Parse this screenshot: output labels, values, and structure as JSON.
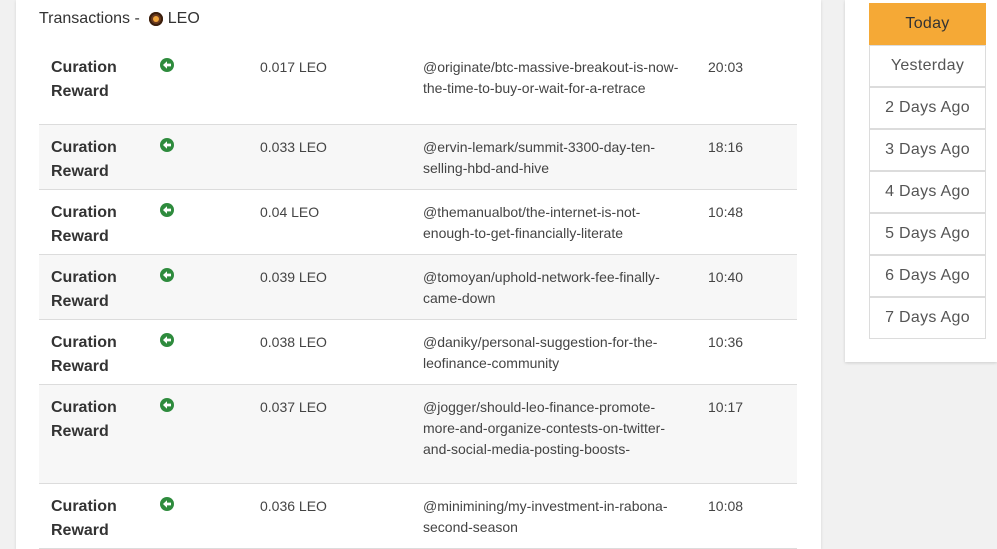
{
  "header": {
    "title": "Transactions -",
    "token": "LEO"
  },
  "colors": {
    "accent": "#f5a936",
    "incoming_icon": "#2e8b3d"
  },
  "transactions": [
    {
      "type": "Curation Reward",
      "icon": "arrow-left-circle-icon",
      "amount": "0.017 LEO",
      "memo": "@originate/btc-massive-breakout-is-now-the-time-to-buy-or-wait-for-a-retrace",
      "time": "20:03"
    },
    {
      "type": "Curation Reward",
      "icon": "arrow-left-circle-icon",
      "amount": "0.033 LEO",
      "memo": "@ervin-lemark/summit-3300-day-ten-selling-hbd-and-hive",
      "time": "18:16"
    },
    {
      "type": "Curation Reward",
      "icon": "arrow-left-circle-icon",
      "amount": "0.04 LEO",
      "memo": "@themanualbot/the-internet-is-not-enough-to-get-financially-literate",
      "time": "10:48"
    },
    {
      "type": "Curation Reward",
      "icon": "arrow-left-circle-icon",
      "amount": "0.039 LEO",
      "memo": "@tomoyan/uphold-network-fee-finally-came-down",
      "time": "10:40"
    },
    {
      "type": "Curation Reward",
      "icon": "arrow-left-circle-icon",
      "amount": "0.038 LEO",
      "memo": "@daniky/personal-suggestion-for-the-leofinance-community",
      "time": "10:36"
    },
    {
      "type": "Curation Reward",
      "icon": "arrow-left-circle-icon",
      "amount": "0.037 LEO",
      "memo": "@jogger/should-leo-finance-promote-more-and-organize-contests-on-twitter-and-social-media-posting-boosts-",
      "time": "10:17"
    },
    {
      "type": "Curation Reward",
      "icon": "arrow-left-circle-icon",
      "amount": "0.036 LEO",
      "memo": "@minimining/my-investment-in-rabona-second-season",
      "time": "10:08"
    }
  ],
  "date_filter": {
    "selected": "Today",
    "options": [
      "Today",
      "Yesterday",
      "2 Days Ago",
      "3 Days Ago",
      "4 Days Ago",
      "5 Days Ago",
      "6 Days Ago",
      "7 Days Ago"
    ]
  }
}
